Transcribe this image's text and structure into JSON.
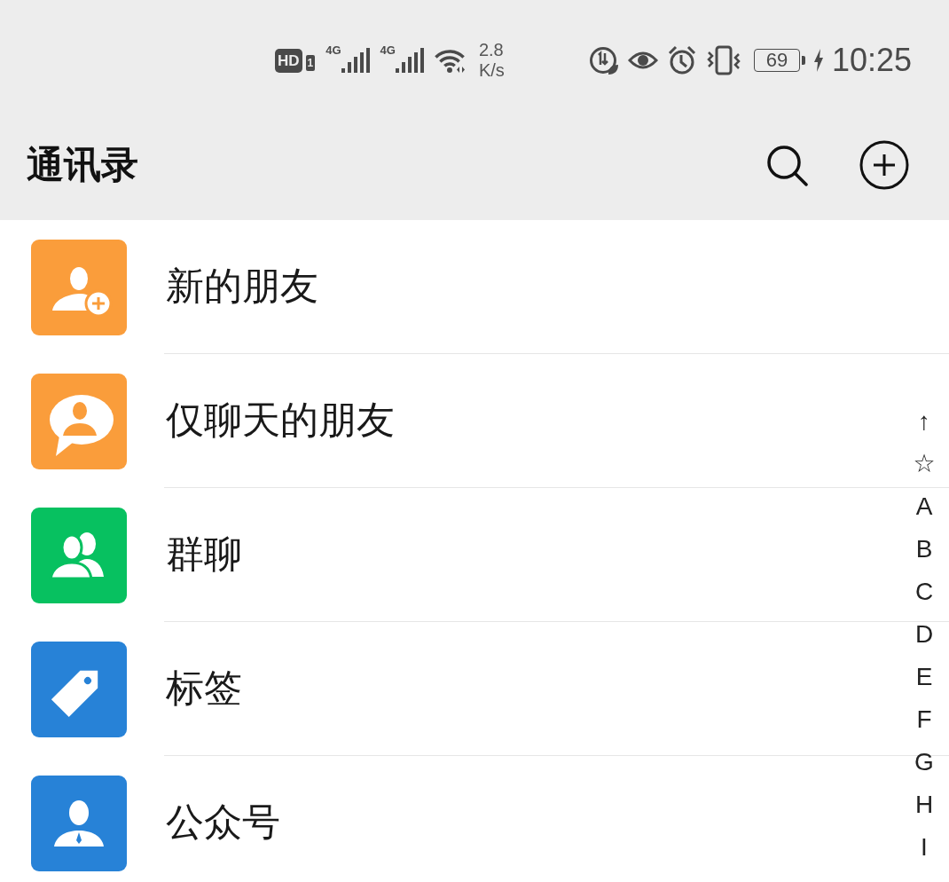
{
  "status_bar": {
    "hd_badge": "HD",
    "sim_badge": "1",
    "networks": [
      {
        "type": "4G"
      },
      {
        "type": "4G"
      }
    ],
    "speed": {
      "value": "2.8",
      "unit": "K/s"
    },
    "battery": {
      "percent": "69",
      "charging": true
    },
    "time": "10:25"
  },
  "header": {
    "title": "通讯录"
  },
  "contacts": [
    {
      "label": "新的朋友",
      "kind": "newfriend",
      "color": "#fa9d3b"
    },
    {
      "label": "仅聊天的朋友",
      "kind": "chat",
      "color": "#fa9d3b"
    },
    {
      "label": "群聊",
      "kind": "group",
      "color": "#07c160"
    },
    {
      "label": "标签",
      "kind": "tag",
      "color": "#2782d7"
    },
    {
      "label": "公众号",
      "kind": "account",
      "color": "#2782d7"
    }
  ],
  "index": [
    "↑",
    "☆",
    "A",
    "B",
    "C",
    "D",
    "E",
    "F",
    "G",
    "H",
    "I"
  ]
}
